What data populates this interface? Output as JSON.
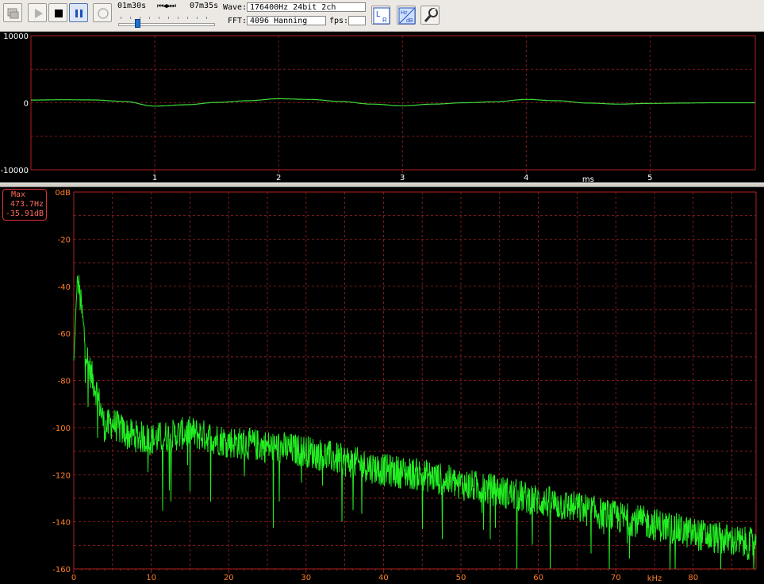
{
  "toolbar": {
    "position_time": "01m30s",
    "total_time": "07m35s",
    "seek_symbols": "⏮◀▶⏭",
    "wave_label": "Wave:",
    "wave_value": "176400Hz 24bit 2ch",
    "fft_label": "FFT:",
    "fft_value": "4096 Hanning",
    "fps_label": "fps:",
    "fps_value": "",
    "hz_label": "Hz",
    "db_label": "dB",
    "l_label": "L",
    "r_label": "R",
    "playback_position": 0.198
  },
  "icons": [
    "monitor-icon",
    "play-icon",
    "stop-icon",
    "pause-icon",
    "record-icon",
    "lr-channel-icon",
    "hz-db-scale-icon",
    "wrench-settings-icon"
  ],
  "waveform": {
    "y_ticks": [
      "10000",
      "0",
      "-10000"
    ],
    "x_ticks": [
      "1",
      "2",
      "3",
      "4",
      "5"
    ],
    "x_unit": "ms",
    "line_color": "#3ddc3d",
    "grid_color": "#a02020"
  },
  "spectrum": {
    "y_ticks": [
      "0dB",
      "-20",
      "-40",
      "-60",
      "-80",
      "-100",
      "-120",
      "-140",
      "-160"
    ],
    "x_ticks": [
      "0",
      "10",
      "20",
      "30",
      "40",
      "50",
      "60",
      "70",
      "80"
    ],
    "x_unit": "kHz",
    "line_color": "#22ee22",
    "grid_color": "#a02020"
  },
  "max_marker": {
    "label": "Max",
    "freq": "473.7Hz",
    "level": "-35.91dB"
  },
  "chart_data": [
    {
      "type": "line",
      "title": "",
      "xlabel": "ms",
      "ylabel": "",
      "xlim": [
        0,
        5.85
      ],
      "ylim": [
        -10000,
        10000
      ],
      "series": [
        {
          "x": [
            0,
            0.25,
            0.5,
            0.75,
            1.0,
            1.25,
            1.5,
            1.75,
            2.0,
            2.25,
            2.5,
            2.75,
            3.0,
            3.25,
            3.5,
            3.75,
            4.0,
            4.25,
            4.5,
            4.75,
            5.0,
            5.25,
            5.5,
            5.85
          ],
          "values": [
            400,
            450,
            420,
            200,
            -500,
            -300,
            50,
            300,
            600,
            500,
            200,
            -200,
            -450,
            -200,
            0,
            150,
            500,
            300,
            -50,
            -200,
            -100,
            -50,
            0,
            0
          ]
        }
      ]
    },
    {
      "type": "line",
      "title": "",
      "xlabel": "kHz",
      "ylabel": "",
      "xlim": [
        0,
        88.2
      ],
      "ylim": [
        -160,
        0
      ],
      "series": [
        {
          "x": [
            0,
            0.47,
            1,
            1.5,
            2,
            3,
            4,
            5,
            7,
            10,
            15,
            20,
            25,
            30,
            35,
            40,
            45,
            50,
            55,
            60,
            65,
            70,
            75,
            80,
            85,
            88.2
          ],
          "values": [
            -72,
            -36,
            -50,
            -65,
            -75,
            -85,
            -100,
            -98,
            -103,
            -105,
            -102,
            -106,
            -108,
            -110,
            -114,
            -118,
            -120,
            -124,
            -127,
            -131,
            -134,
            -138,
            -141,
            -145,
            -148,
            -150
          ]
        }
      ]
    }
  ]
}
